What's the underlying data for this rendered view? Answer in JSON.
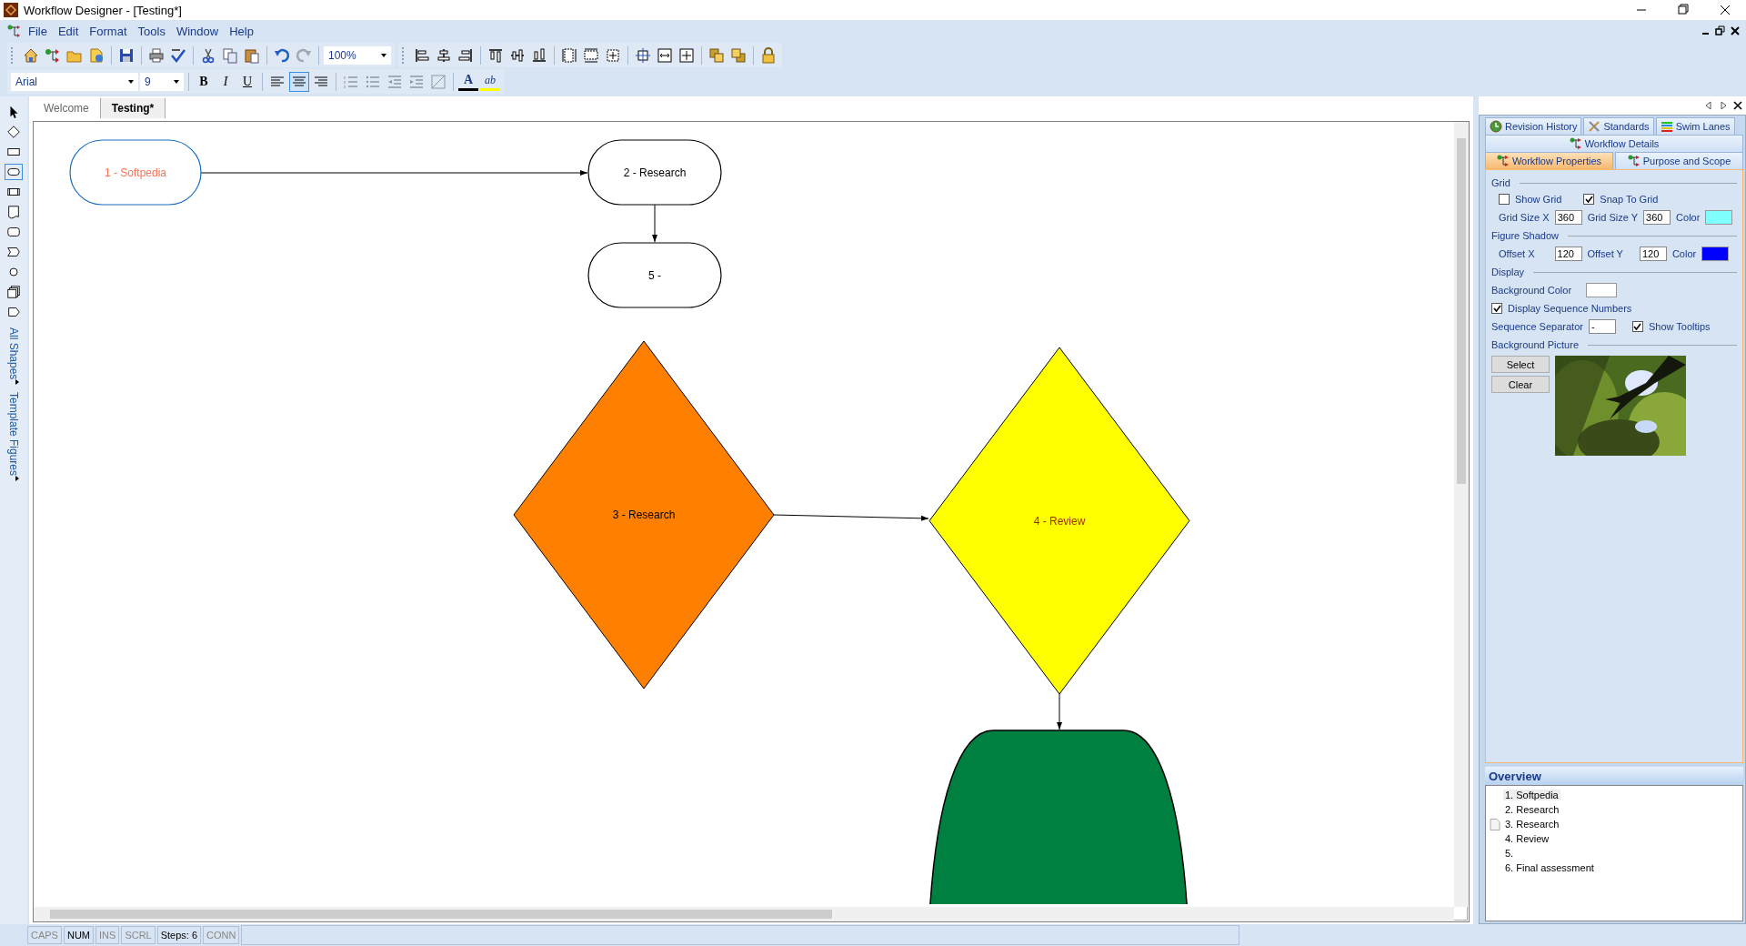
{
  "window": {
    "title": "Workflow Designer - [Testing*]"
  },
  "menu": [
    {
      "label": "File"
    },
    {
      "label": "Edit"
    },
    {
      "label": "Format"
    },
    {
      "label": "Tools"
    },
    {
      "label": "Window"
    },
    {
      "label": "Help"
    }
  ],
  "standard_toolbar": {
    "zoom": "100%"
  },
  "format_toolbar": {
    "font": "Arial",
    "size": "9",
    "style_buttons": [
      {
        "label": "B",
        "kind": "bold"
      },
      {
        "label": "I",
        "kind": "italic"
      },
      {
        "label": "U",
        "kind": "underline"
      }
    ],
    "align_buttons": [
      {
        "kind": "left",
        "selected": false
      },
      {
        "kind": "center",
        "selected": true
      },
      {
        "kind": "right",
        "selected": false
      }
    ],
    "font_color": {
      "label": "A"
    },
    "highlight": {
      "label": "ab"
    }
  },
  "document_tabs": [
    {
      "label": "Welcome",
      "selected": false
    },
    {
      "label": "Testing*",
      "selected": true
    }
  ],
  "toolbox": {
    "tools": [
      {
        "kind": "pointer",
        "selected": false
      },
      {
        "kind": "diamond",
        "selected": false
      },
      {
        "kind": "rectangle",
        "selected": false
      },
      {
        "kind": "terminator",
        "selected": true
      },
      {
        "kind": "process",
        "selected": false
      },
      {
        "kind": "document",
        "selected": false
      },
      {
        "kind": "rounded",
        "selected": false
      },
      {
        "kind": "offpage",
        "selected": false
      },
      {
        "kind": "circle",
        "selected": false
      },
      {
        "kind": "multidoc",
        "selected": false
      },
      {
        "kind": "delay",
        "selected": false
      }
    ],
    "groups": [
      {
        "label": "All Shapes"
      },
      {
        "label": "Template Figures"
      }
    ]
  },
  "diagram": {
    "shapes": [
      {
        "kind": "terminator",
        "label": "1 - Softpedia",
        "selected": true
      },
      {
        "kind": "terminator",
        "label": "2 - Research",
        "selected": false
      },
      {
        "kind": "terminator",
        "label": "5 -",
        "selected": false
      },
      {
        "kind": "diamond",
        "label": "3 - Research",
        "color": "#ff8000",
        "selected": false
      },
      {
        "kind": "diamond",
        "label": "4 - Review",
        "color": "#ffff00",
        "selected": false
      },
      {
        "kind": "arch",
        "color": "#008040",
        "selected": false
      }
    ]
  },
  "properties_panel": {
    "tab_rows": [
      [
        {
          "label": "Revision History",
          "selected": false
        },
        {
          "label": "Standards",
          "selected": false
        },
        {
          "label": "Swim Lanes",
          "selected": false
        }
      ],
      [
        {
          "label": "Workflow Details",
          "selected": false
        }
      ],
      [
        {
          "label": "Workflow Properties",
          "selected": true
        },
        {
          "label": "Purpose and Scope",
          "selected": false
        }
      ]
    ],
    "grid": {
      "title": "Grid",
      "show_grid": {
        "label": "Show Grid",
        "checked": false
      },
      "snap_to_grid": {
        "label": "Snap To Grid",
        "checked": true
      },
      "size_x": {
        "label": "Grid Size X",
        "value": "360"
      },
      "size_y": {
        "label": "Grid Size Y",
        "value": "360"
      },
      "color": {
        "label": "Color",
        "color": "#80ffff"
      }
    },
    "figure_shadow": {
      "title": "Figure Shadow",
      "offset_x": {
        "label": "Offset X",
        "value": "120"
      },
      "offset_y": {
        "label": "Offset Y",
        "value": "120"
      },
      "color": {
        "label": "Color",
        "color": "#0000ff"
      }
    },
    "display": {
      "title": "Display",
      "background_color": {
        "label": "Background Color",
        "color": "#ffffff"
      },
      "sequence_numbers": {
        "label": "Display Sequence Numbers",
        "checked": true
      },
      "separator": {
        "label": "Sequence Separator",
        "value": "-"
      },
      "tooltips": {
        "label": "Show Tooltips",
        "checked": true
      }
    },
    "background_picture": {
      "title": "Background Picture",
      "buttons": [
        {
          "label": "Select"
        },
        {
          "label": "Clear"
        }
      ]
    }
  },
  "overview": {
    "title": "Overview",
    "items": [
      {
        "label": "1. Softpedia",
        "kind": "step",
        "selected": true
      },
      {
        "label": "2. Research",
        "kind": "step",
        "selected": false
      },
      {
        "label": "3. Research",
        "kind": "document",
        "selected": false
      },
      {
        "label": "4. Review",
        "kind": "step",
        "selected": false
      },
      {
        "label": "5.",
        "kind": "step",
        "selected": false
      },
      {
        "label": "6. Final assessment",
        "kind": "step",
        "selected": false
      }
    ]
  },
  "status_bar": [
    {
      "label": "CAPS",
      "on": false
    },
    {
      "label": "NUM",
      "on": true
    },
    {
      "label": "INS",
      "on": false
    },
    {
      "label": "SCRL",
      "on": false
    },
    {
      "label": "Steps: 6",
      "on": true
    },
    {
      "label": "CONN",
      "on": false
    }
  ]
}
